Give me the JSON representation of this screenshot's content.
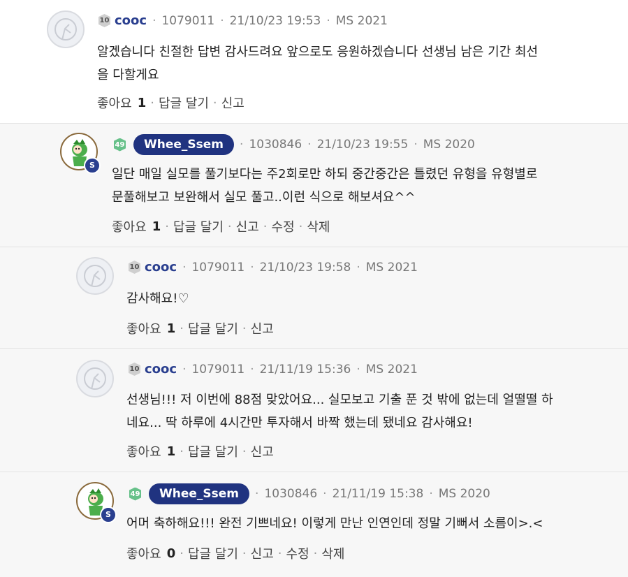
{
  "comments": [
    {
      "level": "10",
      "nickname": "cooc",
      "user_id": "1079011",
      "datetime": "21/10/23 19:53",
      "program": "MS 2021",
      "text_lines": [
        "알겠습니다 친절한 답변 감사드려요 앞으로도 응원하겠습니다 선생님 남은 기간 최선",
        "을 다할게요"
      ],
      "like_label": "좋아요",
      "like_count": "1",
      "reply_label": "답글 달기",
      "report_label": "신고"
    },
    {
      "level": "49",
      "nickname": "Whee_Ssem",
      "user_id": "1030846",
      "datetime": "21/10/23 19:55",
      "program": "MS 2020",
      "badge": "S",
      "text_lines": [
        "일단 매일 실모를 풀기보다는 주2회로만 하되 중간중간은 틀렸던 유형을 유형별로",
        "문풀해보고 보완해서 실모 풀고..이런 식으로 해보셔요^^"
      ],
      "like_label": "좋아요",
      "like_count": "1",
      "reply_label": "답글 달기",
      "report_label": "신고",
      "edit_label": "수정",
      "delete_label": "삭제"
    },
    {
      "level": "10",
      "nickname": "cooc",
      "user_id": "1079011",
      "datetime": "21/10/23 19:58",
      "program": "MS 2021",
      "text_lines": [
        "감사해요!♡"
      ],
      "like_label": "좋아요",
      "like_count": "1",
      "reply_label": "답글 달기",
      "report_label": "신고"
    },
    {
      "level": "10",
      "nickname": "cooc",
      "user_id": "1079011",
      "datetime": "21/11/19 15:36",
      "program": "MS 2021",
      "text_lines": [
        "선생님!!! 저 이번에 88점 맞았어요... 실모보고 기출 푼 것 밖에 없는데 얼떨떨 하",
        "네요... 딱 하루에 4시간만 투자해서 바짝 했는데 됐네요 감사해요!"
      ],
      "like_label": "좋아요",
      "like_count": "1",
      "reply_label": "답글 달기",
      "report_label": "신고"
    },
    {
      "level": "49",
      "nickname": "Whee_Ssem",
      "user_id": "1030846",
      "datetime": "21/11/19 15:38",
      "program": "MS 2020",
      "badge": "S",
      "text_lines": [
        "어머 축하해요!!! 완전 기쁘네요! 이렇게 만난 인연인데 정말 기뻐서 소름이>.<"
      ],
      "like_label": "좋아요",
      "like_count": "0",
      "reply_label": "답글 달기",
      "report_label": "신고",
      "edit_label": "수정",
      "delete_label": "삭제"
    }
  ],
  "separator_dot": "·",
  "colors": {
    "nick_plain": "#2a3f8f",
    "nick_pill_bg": "#203380",
    "level_green": "#67c18a",
    "reply_bg": "#f7f7f7"
  }
}
